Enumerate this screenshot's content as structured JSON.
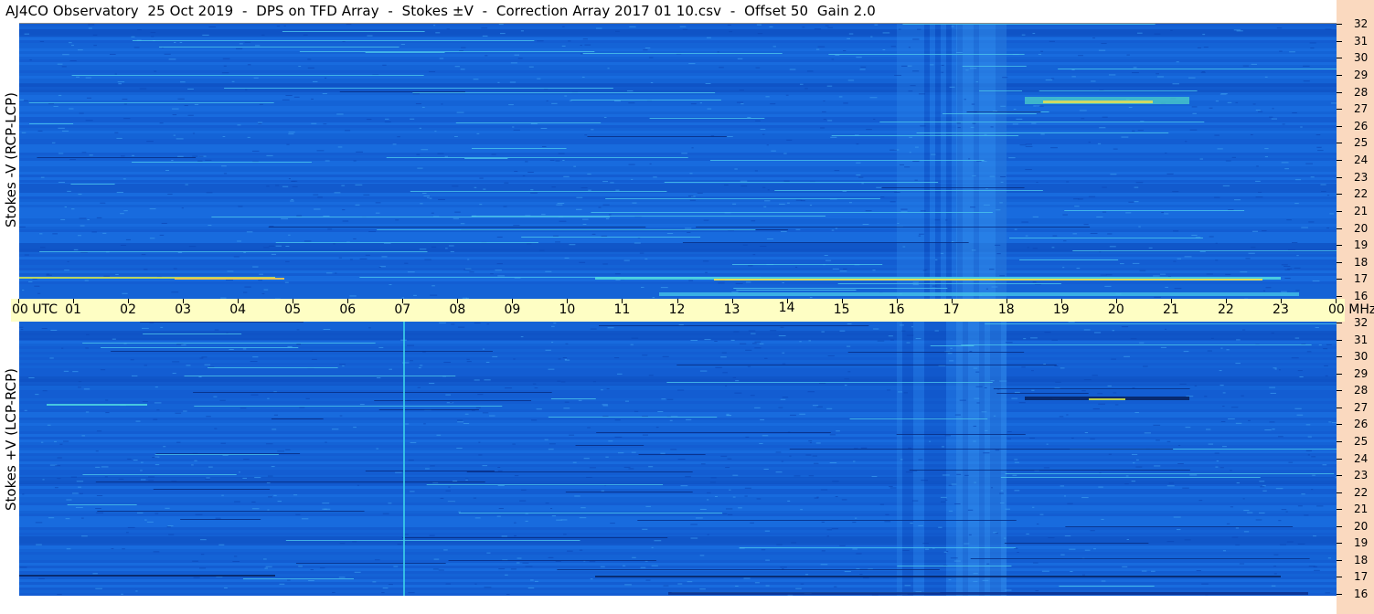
{
  "title": "AJ4CO Observatory  25 Oct 2019  -  DPS on TFD Array  -  Stokes ±V  -  Correction Array 2017 01 10.csv  -  Offset 50  Gain 2.0",
  "panels": {
    "top": {
      "ylabel": "Stokes -V (RCP-LCP)"
    },
    "bottom": {
      "ylabel": "Stokes +V (LCP-RCP)"
    }
  },
  "time_axis": {
    "labels": [
      "00  UTC",
      "01",
      "02",
      "03",
      "04",
      "05",
      "06",
      "07",
      "08",
      "09",
      "10",
      "11",
      "12",
      "13",
      "14",
      "15",
      "16",
      "17",
      "18",
      "19",
      "20",
      "21",
      "22",
      "23",
      "00 MHz"
    ]
  },
  "freq_axis": {
    "labels": [
      "32",
      "31",
      "30",
      "29",
      "28",
      "27",
      "26",
      "25",
      "24",
      "23",
      "22",
      "21",
      "20",
      "19",
      "18",
      "17",
      "16"
    ]
  },
  "colors": {
    "background_blue": "#1565d8",
    "deep_blue": "#0a3fae",
    "cyan_feature": "#3fd3e8",
    "yellow_feature": "#f2e24a",
    "time_axis_bg": "#fefec4",
    "freq_strip_bg": "#fad9bf"
  },
  "chart_data": {
    "type": "heatmap",
    "title": "AJ4CO Observatory  25 Oct 2019  -  DPS on TFD Array  -  Stokes ±V  -  Correction Array 2017 01 10.csv  -  Offset 50  Gain 2.0",
    "x_unit": "UTC",
    "x_range": [
      0,
      24
    ],
    "y_unit": "MHz",
    "y_range": [
      16,
      32
    ],
    "panels": [
      "Stokes -V (RCP-LCP)",
      "Stokes +V (LCP-RCP)"
    ]
  }
}
